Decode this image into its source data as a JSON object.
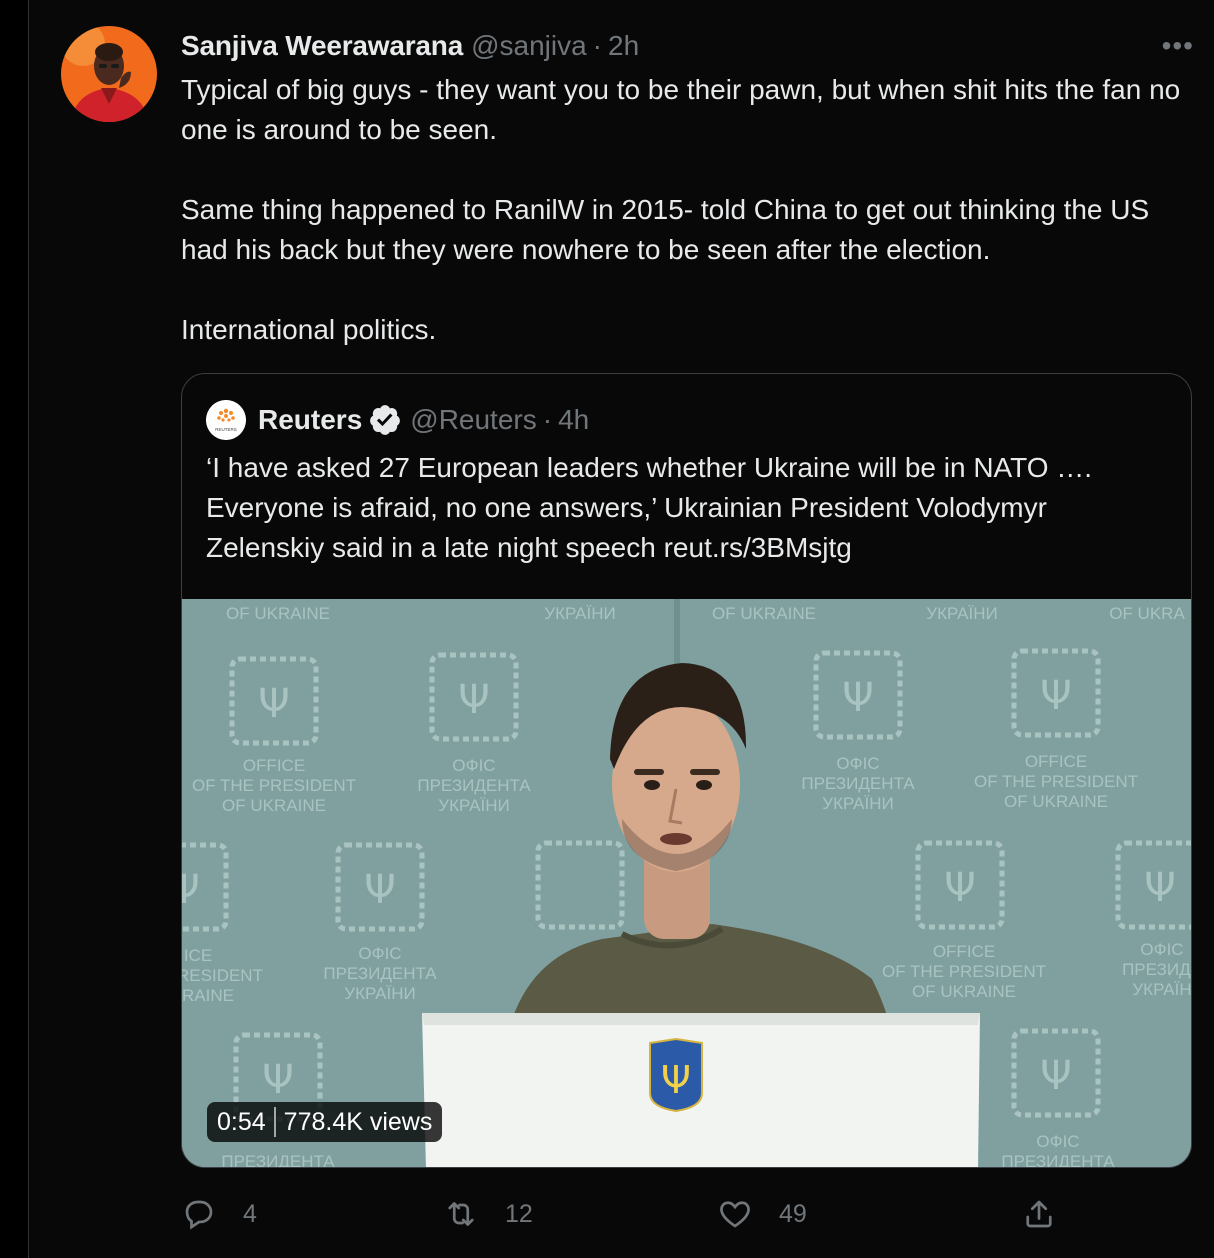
{
  "tweet": {
    "display_name": "Sanjiva Weerawarana",
    "handle": "@sanjiva",
    "separator": "·",
    "time": "2h",
    "more_label": "•••",
    "paragraphs": [
      "Typical of big guys - they want you to be their pawn, but when shit hits the fan no one is around to be seen.",
      "Same thing happened to RanilW in 2015- told China to get out thinking the US had his back but they were nowhere to be seen after the election.",
      "International politics."
    ],
    "avatar_icon": "person-photo"
  },
  "quote": {
    "display_name": "Reuters",
    "verified_icon": "verified-badge-icon",
    "handle": "@Reuters",
    "separator": "·",
    "time": "4h",
    "logo_text": "REUTERS",
    "text": "‘I have asked 27 European leaders whether Ukraine will be in NATO …. Everyone is afraid, no one answers,’ Ukrainian President Volodymyr Zelenskiy said in a late night speech reut.rs/3BMsjtg",
    "video": {
      "duration": "0:54",
      "views": "778.4K views",
      "backdrop_text": [
        "OF UKRAINE",
        "УКРАЇНИ",
        "OF UKRAINE",
        "УКРАЇНИ",
        "OF UKRA",
        "OFFICE",
        "OF THE PRESIDENT",
        "OF UKRAINE",
        "ОФІС",
        "ПРЕЗИДЕНТА",
        "УКРАЇНИ",
        "ОФІС",
        "ПРЕЗИДЕНТА",
        "УКРАЇНИ",
        "OFFICE",
        "OF THE PRESIDENT",
        "OF UKRAINE",
        "ICE",
        "RESIDENT",
        "RAINE",
        "ОФІС",
        "ПРЕЗИДЕНТА",
        "УКРАЇНИ",
        "OFFICE",
        "OF THE PRESIDENT",
        "OF UKRAINE",
        "ОФІС",
        "ПРЕЗИДЕ",
        "УКРАЇН",
        "ОФІС",
        "ПРЕЗИДЕНТА",
        "ПРЕЗИДЕНТА",
        "OF"
      ]
    }
  },
  "actions": {
    "reply_count": "4",
    "retweet_count": "12",
    "like_count": "49",
    "icons": [
      "reply-icon",
      "retweet-icon",
      "like-icon",
      "share-icon"
    ]
  },
  "colors": {
    "background": "#080808",
    "text": "#e7e9ea",
    "muted": "#71767b",
    "border": "#3a3f44",
    "avatar_bg": "#f26b1d",
    "wall": "#7fa09f",
    "shirt": "#5a5a45",
    "podium": "#f2f4f2",
    "coat_of_arms": "#2a5aa8"
  }
}
